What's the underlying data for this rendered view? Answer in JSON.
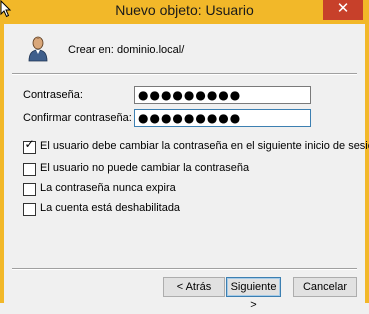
{
  "window": {
    "title": "Nuevo objeto: Usuario",
    "close_glyph": "✕"
  },
  "header": {
    "created_in_label": "Crear en:",
    "created_in_value": "dominio.local/"
  },
  "form": {
    "password_label": "Contraseña:",
    "password_value": "●●●●●●●●●",
    "confirm_label": "Confirmar contraseña:",
    "confirm_value": "●●●●●●●●●"
  },
  "options": [
    {
      "label": "El usuario debe cambiar la contraseña en el siguiente inicio de sesión",
      "checked": true
    },
    {
      "label": "El usuario no puede cambiar la contraseña",
      "checked": false
    },
    {
      "label": "La contraseña nunca expira",
      "checked": false
    },
    {
      "label": "La cuenta está deshabilitada",
      "checked": false
    }
  ],
  "buttons": {
    "back": "< Atrás",
    "next": "Siguiente >",
    "cancel": "Cancelar"
  },
  "colors": {
    "title_bar": "#f2b829",
    "close_button": "#c7402a",
    "background": "#f0f0f0"
  },
  "icons": {
    "user": "user-icon",
    "close": "close-icon",
    "cursor": "mouse-cursor-icon",
    "check": "checkmark-icon"
  }
}
